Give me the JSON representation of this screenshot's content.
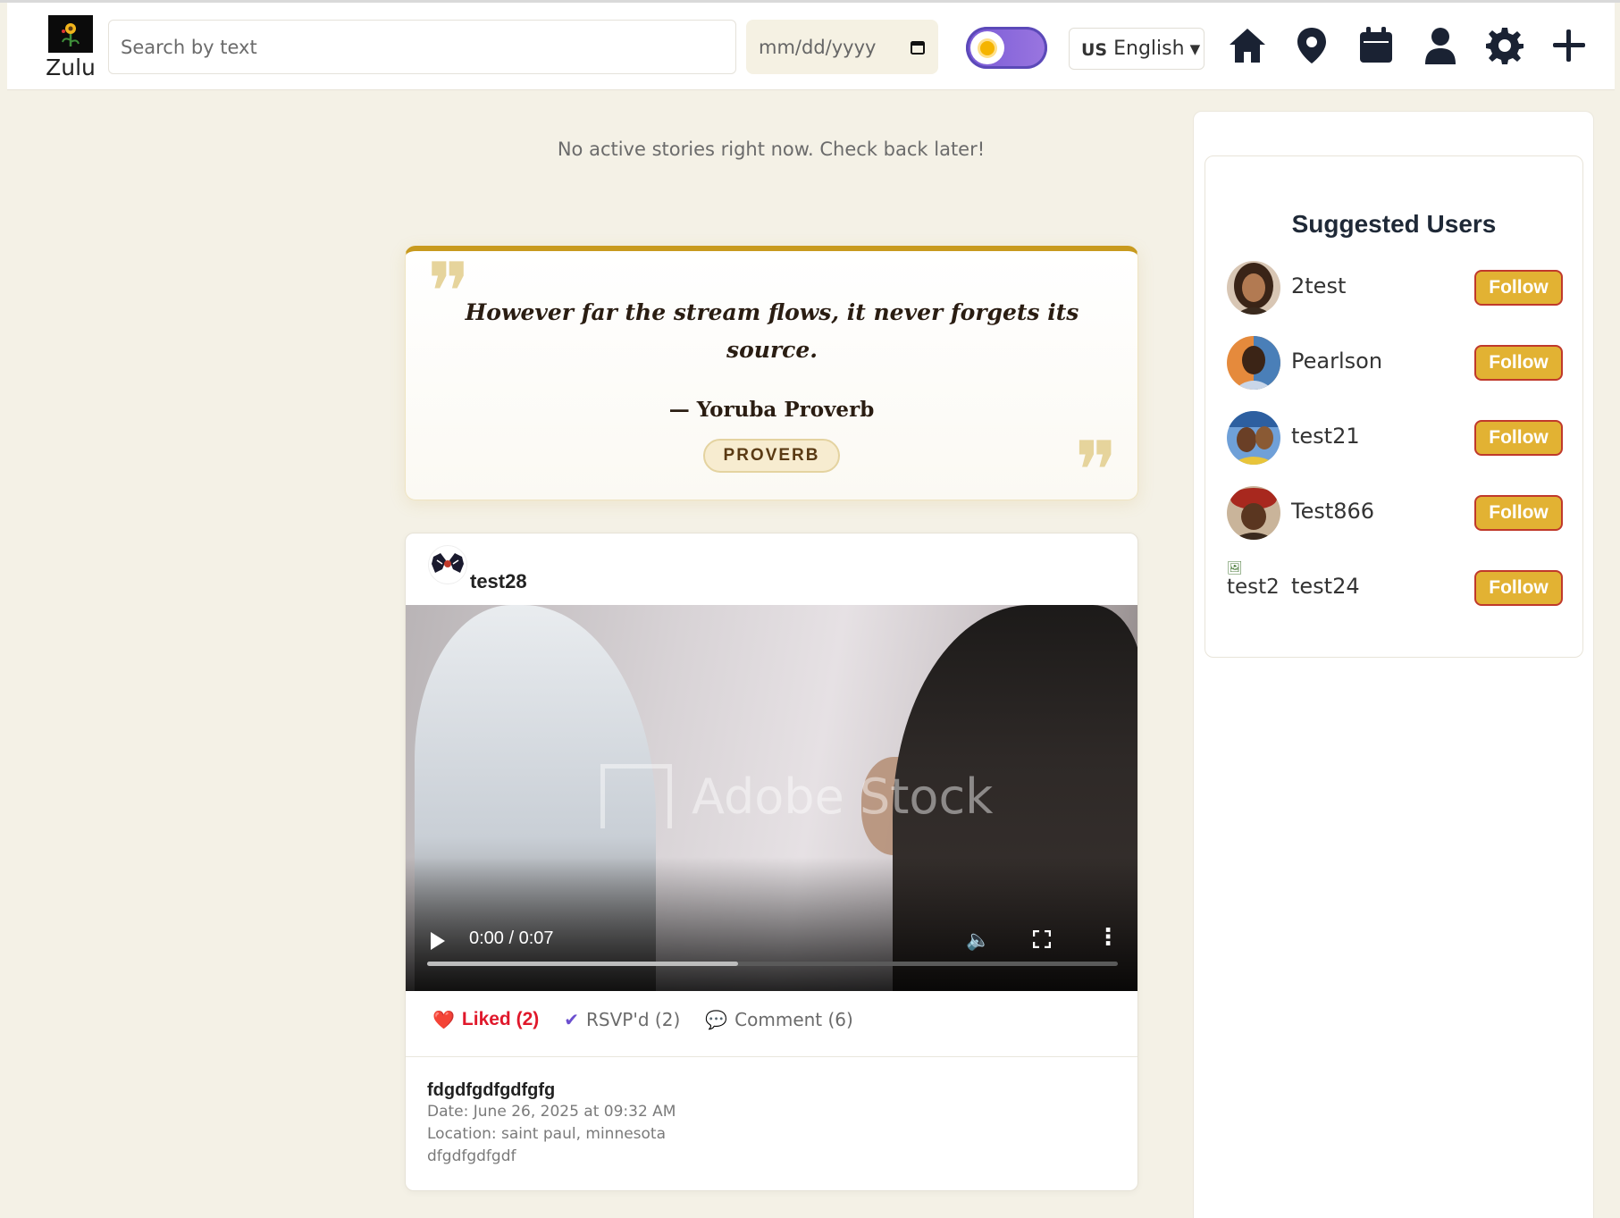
{
  "header": {
    "logo_text": "Zulu",
    "search_placeholder": "Search by text",
    "date_placeholder": "mm/dd/yyyy",
    "language_flag": "US",
    "language": "English",
    "nav_icons": [
      "home-icon",
      "location-pin-icon",
      "calendar-icon",
      "profile-icon",
      "settings-gear-icon",
      "add-plus-icon"
    ]
  },
  "stories": {
    "empty_message": "No active stories right now. Check back later!"
  },
  "quote": {
    "text": "However far the stream flows, it never forgets its source.",
    "author": "— Yoruba Proverb",
    "tag": "PROVERB",
    "accent_color": "#c89a1e"
  },
  "post": {
    "username": "test28",
    "video": {
      "time": "0:00 / 0:07",
      "watermark": "Adobe Stock"
    },
    "actions": {
      "liked": "Liked (2)",
      "rsvp": "RSVP'd (2)",
      "comment": "Comment (6)"
    },
    "title": "fdgdfgdfgdfgfg",
    "date": "Date: June 26, 2025 at 09:32 AM",
    "location": "Location: saint paul, minnesota",
    "description": "dfgdfgdfgdf"
  },
  "suggested": {
    "title": "Suggested Users",
    "follow_label": "Follow",
    "users": [
      {
        "name": "2test",
        "avatar_color": "#8b5a3c"
      },
      {
        "name": "Pearlson",
        "avatar_color": "#e07a3a"
      },
      {
        "name": "test21",
        "avatar_color": "#3c6fb4"
      },
      {
        "name": "Test866",
        "avatar_color": "#b23a2c"
      },
      {
        "name": "test24",
        "avatar_alt": "test2"
      }
    ]
  }
}
